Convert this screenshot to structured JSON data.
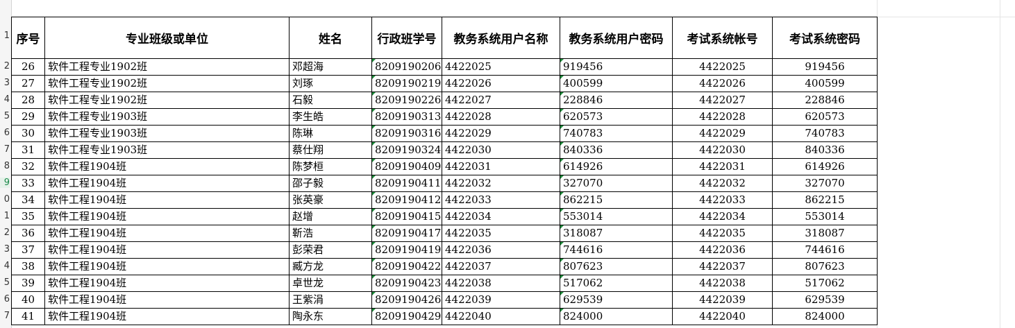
{
  "headers": [
    "序号",
    "专业班级或单位",
    "姓名",
    "行政班学号",
    "教务系统用户名称",
    "教务系统用户密码",
    "考试系统帐号",
    "考试系统密码"
  ],
  "row_numbers": [
    "1",
    "2",
    "3",
    "4",
    "5",
    "6",
    "7",
    "8",
    "9",
    "0",
    "1",
    "2",
    "3",
    "4",
    "5",
    "6",
    "7"
  ],
  "rows": [
    {
      "seq": "26",
      "class": "软件工程专业1902班",
      "name": "邓超海",
      "sid": "8209190206",
      "user": "4422025",
      "pwd": "919456",
      "exam_acc": "4422025",
      "exam_pwd": "919456"
    },
    {
      "seq": "27",
      "class": "软件工程专业1902班",
      "name": "刘琢",
      "sid": "8209190219",
      "user": "4422026",
      "pwd": "400599",
      "exam_acc": "4422026",
      "exam_pwd": "400599"
    },
    {
      "seq": "28",
      "class": "软件工程专业1902班",
      "name": "石毅",
      "sid": "8209190226",
      "user": "4422027",
      "pwd": "228846",
      "exam_acc": "4422027",
      "exam_pwd": "228846"
    },
    {
      "seq": "29",
      "class": "软件工程专业1903班",
      "name": "李生皓",
      "sid": "8209190313",
      "user": "4422028",
      "pwd": "620573",
      "exam_acc": "4422028",
      "exam_pwd": "620573"
    },
    {
      "seq": "30",
      "class": "软件工程专业1903班",
      "name": "陈琳",
      "sid": "8209190316",
      "user": "4422029",
      "pwd": "740783",
      "exam_acc": "4422029",
      "exam_pwd": "740783"
    },
    {
      "seq": "31",
      "class": "软件工程专业1903班",
      "name": "蔡仕翔",
      "sid": "8209190324",
      "user": "4422030",
      "pwd": "840336",
      "exam_acc": "4422030",
      "exam_pwd": "840336"
    },
    {
      "seq": "32",
      "class": "软件工程1904班",
      "name": "陈梦桓",
      "sid": "8209190409",
      "user": "4422031",
      "pwd": "614926",
      "exam_acc": "4422031",
      "exam_pwd": "614926"
    },
    {
      "seq": "33",
      "class": "软件工程1904班",
      "name": "邵子毅",
      "sid": "8209190411",
      "user": "4422032",
      "pwd": "327070",
      "exam_acc": "4422032",
      "exam_pwd": "327070"
    },
    {
      "seq": "34",
      "class": "软件工程1904班",
      "name": "张英豪",
      "sid": "8209190412",
      "user": "4422033",
      "pwd": "862215",
      "exam_acc": "4422033",
      "exam_pwd": "862215"
    },
    {
      "seq": "35",
      "class": "软件工程1904班",
      "name": "赵增",
      "sid": "8209190415",
      "user": "4422034",
      "pwd": "553014",
      "exam_acc": "4422034",
      "exam_pwd": "553014"
    },
    {
      "seq": "36",
      "class": "软件工程1904班",
      "name": "靳浩",
      "sid": "8209190417",
      "user": "4422035",
      "pwd": "318087",
      "exam_acc": "4422035",
      "exam_pwd": "318087"
    },
    {
      "seq": "37",
      "class": "软件工程1904班",
      "name": "彭荣君",
      "sid": "8209190419",
      "user": "4422036",
      "pwd": "744616",
      "exam_acc": "4422036",
      "exam_pwd": "744616"
    },
    {
      "seq": "38",
      "class": "软件工程1904班",
      "name": "臧方龙",
      "sid": "8209190422",
      "user": "4422037",
      "pwd": "807623",
      "exam_acc": "4422037",
      "exam_pwd": "807623"
    },
    {
      "seq": "39",
      "class": "软件工程1904班",
      "name": "卓世龙",
      "sid": "8209190423",
      "user": "4422038",
      "pwd": "517062",
      "exam_acc": "4422038",
      "exam_pwd": "517062"
    },
    {
      "seq": "40",
      "class": "软件工程1904班",
      "name": "王紫涓",
      "sid": "8209190426",
      "user": "4422039",
      "pwd": "629539",
      "exam_acc": "4422039",
      "exam_pwd": "629539"
    },
    {
      "seq": "41",
      "class": "软件工程1904班",
      "name": "陶永东",
      "sid": "8209190429",
      "user": "4422040",
      "pwd": "824000",
      "exam_acc": "4422040",
      "exam_pwd": "824000"
    }
  ],
  "colors": {
    "cell_marker": "#1e8c3a",
    "active_row": "#1a8a4a"
  }
}
